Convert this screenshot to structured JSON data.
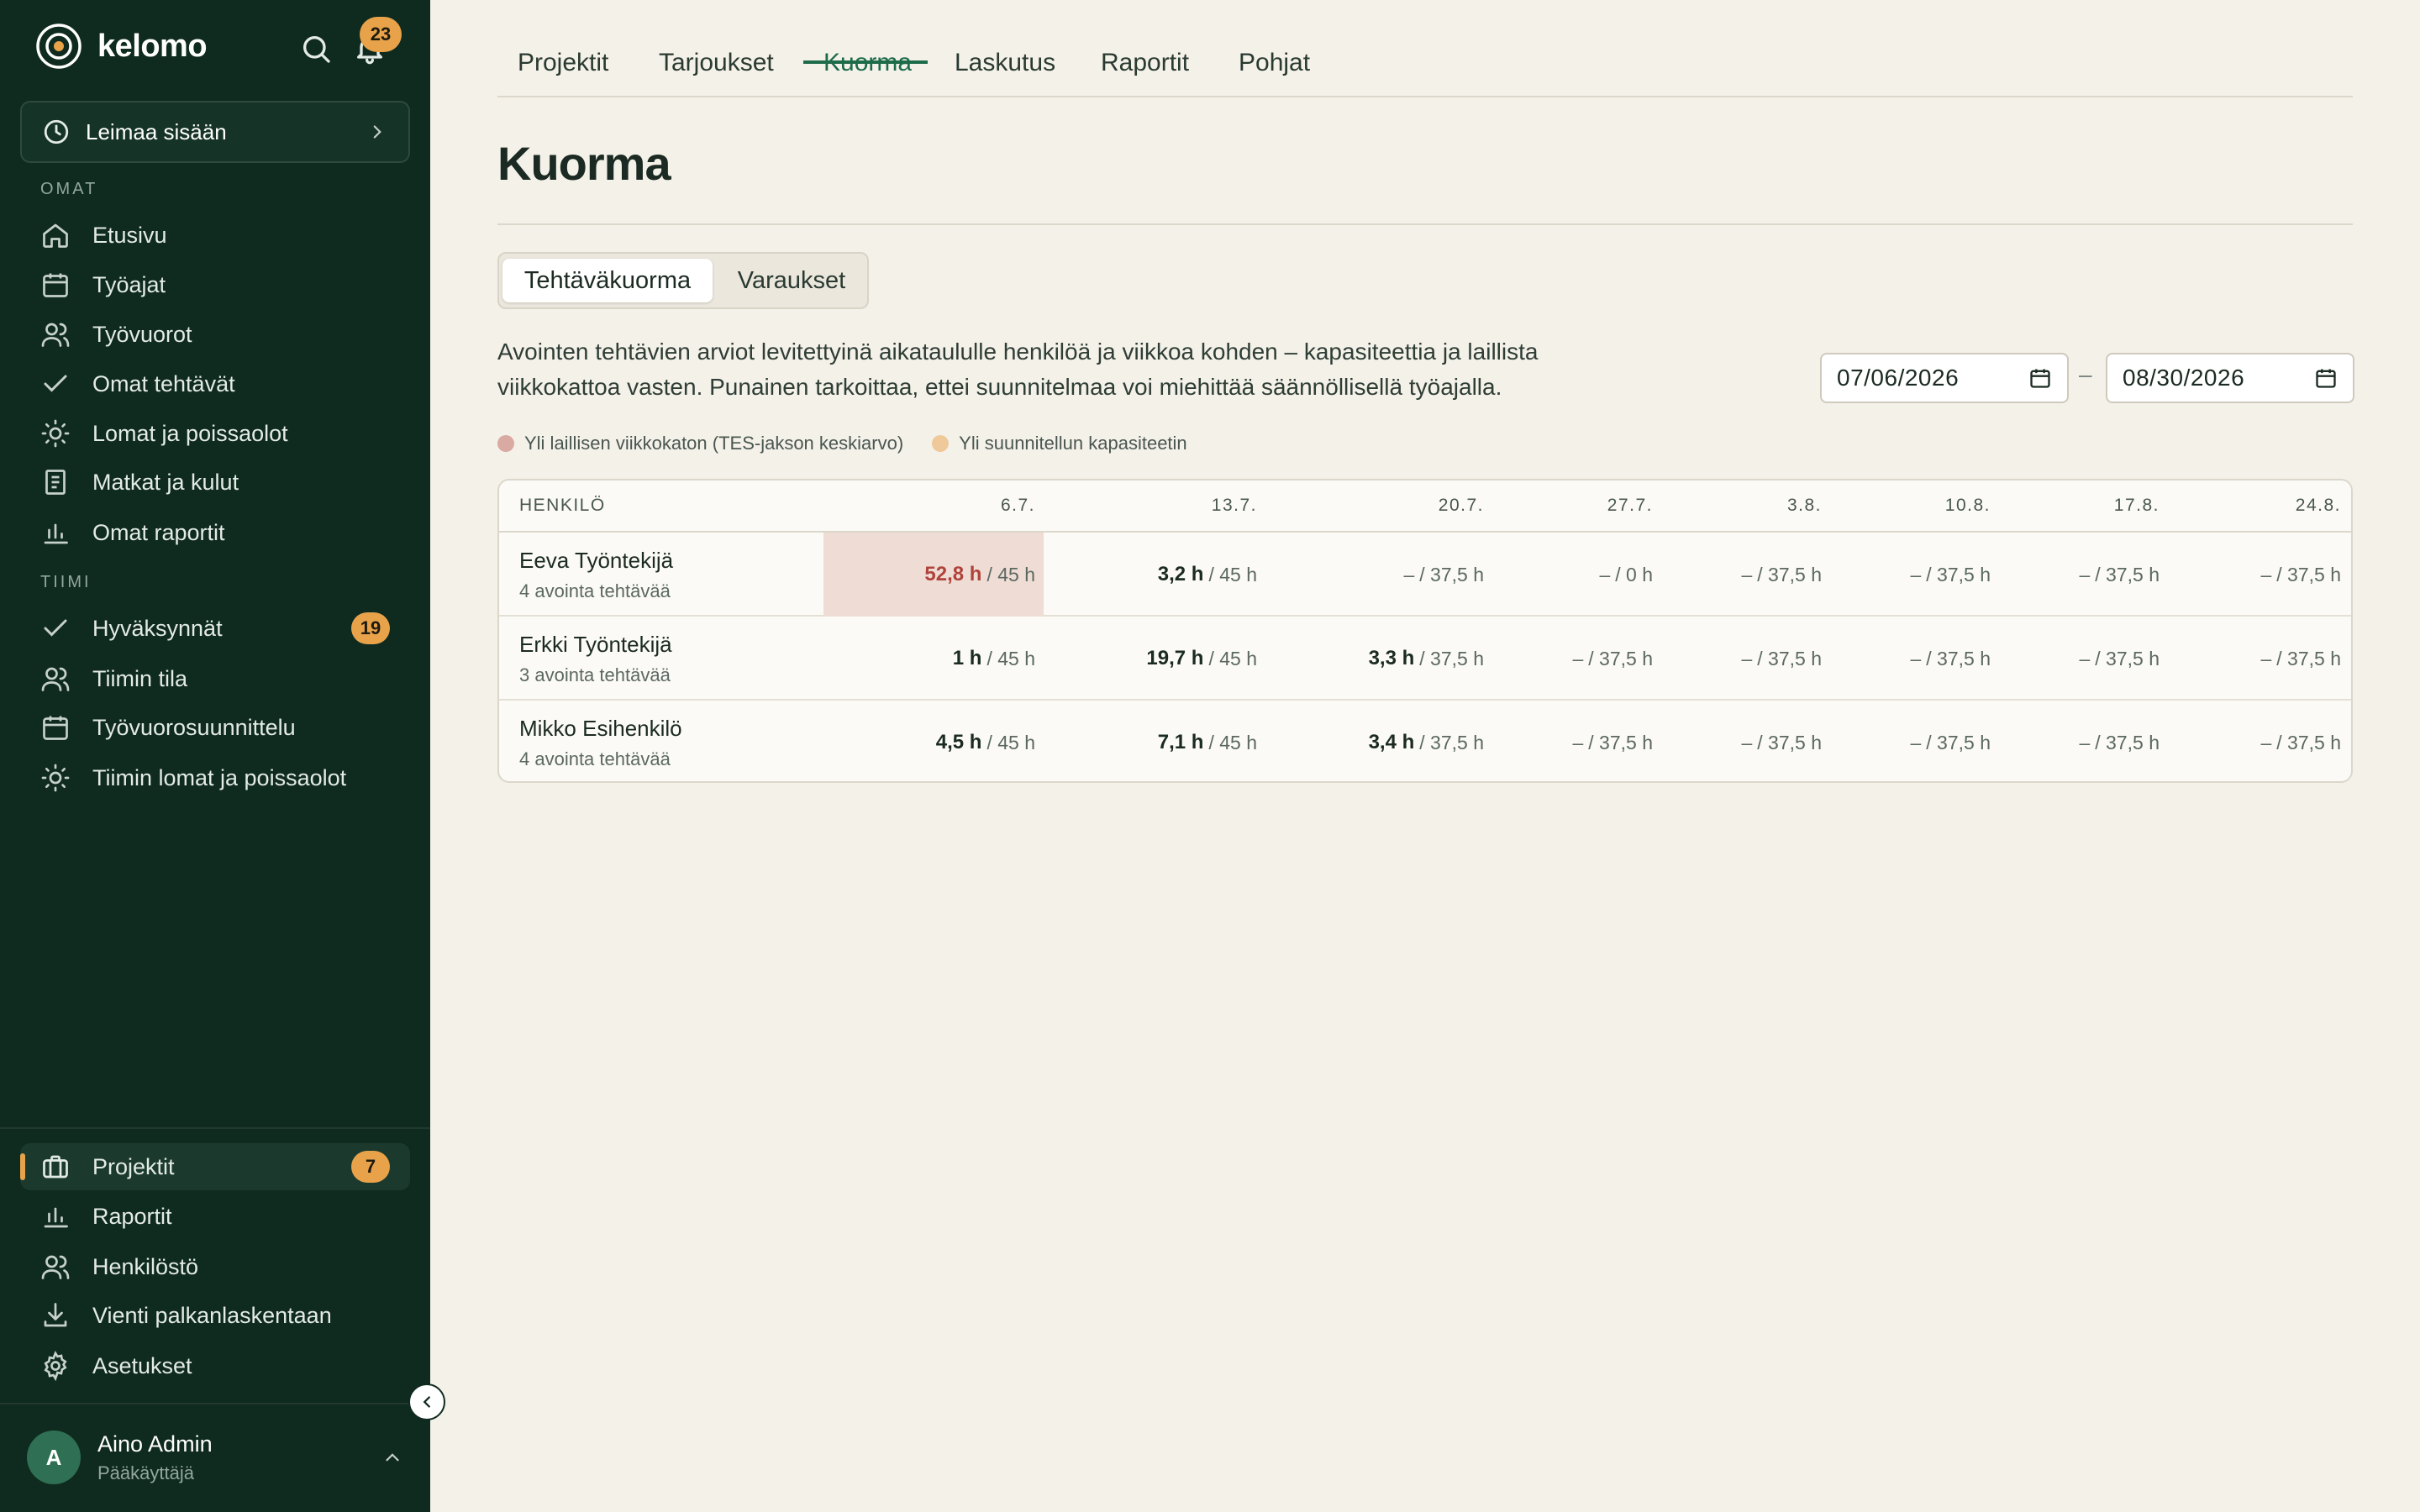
{
  "app": {
    "brand": "kelomo",
    "notification_count": "23",
    "clock_in_label": "Leimaa sisään"
  },
  "sidebar": {
    "section_own": "OMAT",
    "own_items": [
      {
        "label": "Etusivu",
        "icon": "home-icon"
      },
      {
        "label": "Työajat",
        "icon": "calendar-icon"
      },
      {
        "label": "Työvuorot",
        "icon": "users-icon"
      },
      {
        "label": "Omat tehtävät",
        "icon": "check-icon"
      },
      {
        "label": "Lomat ja poissaolot",
        "icon": "sun-icon"
      },
      {
        "label": "Matkat ja kulut",
        "icon": "receipt-icon"
      },
      {
        "label": "Omat raportit",
        "icon": "bar-chart-icon"
      }
    ],
    "section_team": "TIIMI",
    "team_items": [
      {
        "label": "Hyväksynnät",
        "icon": "check-icon",
        "badge": "19"
      },
      {
        "label": "Tiimin tila",
        "icon": "users-icon"
      },
      {
        "label": "Työvuorosuunnittelu",
        "icon": "calendar-icon"
      },
      {
        "label": "Tiimin lomat ja poissaolot",
        "icon": "sun-icon"
      }
    ],
    "bottom_items": [
      {
        "label": "Projektit",
        "icon": "briefcase-icon",
        "badge": "7",
        "active": true
      },
      {
        "label": "Raportit",
        "icon": "bar-chart-icon"
      },
      {
        "label": "Henkilöstö",
        "icon": "users-icon"
      },
      {
        "label": "Vienti palkanlaskentaan",
        "icon": "download-icon"
      },
      {
        "label": "Asetukset",
        "icon": "gear-icon"
      }
    ],
    "user": {
      "initial": "A",
      "name": "Aino Admin",
      "role": "Pääkäyttäjä"
    }
  },
  "tabs": [
    {
      "label": "Projektit"
    },
    {
      "label": "Tarjoukset"
    },
    {
      "label": "Kuorma",
      "active": true
    },
    {
      "label": "Laskutus"
    },
    {
      "label": "Raportit"
    },
    {
      "label": "Pohjat"
    }
  ],
  "page": {
    "title": "Kuorma",
    "segments": [
      "Tehtäväkuorma",
      "Varaukset"
    ],
    "description": "Avointen tehtävien arviot levitettyinä aikataululle henkilöä ja viikkoa kohden – kapasiteettia ja laillista viikkokattoa vasten. Punainen tarkoittaa, ettei suunnitelmaa voi miehittää säännöllisellä työajalla.",
    "date_from": "07/06/2026",
    "date_to": "08/30/2026",
    "date_separator": "–",
    "legend": [
      {
        "label": "Yli laillisen viikkokaton (TES-jakson keskiarvo)",
        "color": "#d9aaa2"
      },
      {
        "label": "Yli suunnitellun kapasiteetin",
        "color": "#f0c99a"
      }
    ]
  },
  "table": {
    "person_header": "HENKILÖ",
    "weeks": [
      "6.7.",
      "13.7.",
      "20.7.",
      "27.7.",
      "3.8.",
      "10.8.",
      "17.8.",
      "24.8."
    ],
    "rows": [
      {
        "name": "Eeva Työntekijä",
        "sub": "4 avointa tehtävää",
        "cells": [
          {
            "h": "52,8 h",
            "cap": "/ 45 h",
            "over": true
          },
          {
            "h": "3,2 h",
            "cap": "/ 45 h"
          },
          {
            "h": "–",
            "cap": "/ 37,5 h"
          },
          {
            "h": "–",
            "cap": "/ 0 h"
          },
          {
            "h": "–",
            "cap": "/ 37,5 h"
          },
          {
            "h": "–",
            "cap": "/ 37,5 h"
          },
          {
            "h": "–",
            "cap": "/ 37,5 h"
          },
          {
            "h": "–",
            "cap": "/ 37,5 h"
          }
        ]
      },
      {
        "name": "Erkki Työntekijä",
        "sub": "3 avointa tehtävää",
        "cells": [
          {
            "h": "1 h",
            "cap": "/ 45 h"
          },
          {
            "h": "19,7 h",
            "cap": "/ 45 h"
          },
          {
            "h": "3,3 h",
            "cap": "/ 37,5 h"
          },
          {
            "h": "–",
            "cap": "/ 37,5 h"
          },
          {
            "h": "–",
            "cap": "/ 37,5 h"
          },
          {
            "h": "–",
            "cap": "/ 37,5 h"
          },
          {
            "h": "–",
            "cap": "/ 37,5 h"
          },
          {
            "h": "–",
            "cap": "/ 37,5 h"
          }
        ]
      },
      {
        "name": "Mikko Esihenkilö",
        "sub": "4 avointa tehtävää",
        "cells": [
          {
            "h": "4,5 h",
            "cap": "/ 45 h"
          },
          {
            "h": "7,1 h",
            "cap": "/ 45 h"
          },
          {
            "h": "3,4 h",
            "cap": "/ 37,5 h"
          },
          {
            "h": "–",
            "cap": "/ 37,5 h"
          },
          {
            "h": "–",
            "cap": "/ 37,5 h"
          },
          {
            "h": "–",
            "cap": "/ 37,5 h"
          },
          {
            "h": "–",
            "cap": "/ 37,5 h"
          },
          {
            "h": "–",
            "cap": "/ 37,5 h"
          }
        ]
      }
    ]
  },
  "colors": {
    "sidebar_bg": "#0f2a1f",
    "accent": "#e7a24a",
    "active_tab": "#1d6b49",
    "over_limit_bg": "#efdcd5",
    "over_limit_text": "#b0433a"
  }
}
